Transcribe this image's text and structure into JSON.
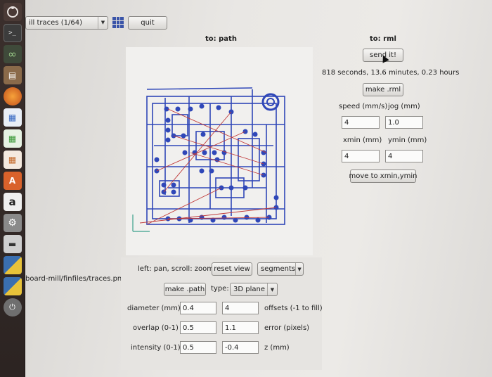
{
  "toolbar": {
    "selected_file": "ill traces (1/64)",
    "quit_label": "quit"
  },
  "left_column": {
    "header": "to: path",
    "file_path": "board-mill/finfiles/traces.png",
    "view_hint": "left: pan, scroll: zoom",
    "reset_view_label": "reset view",
    "display_mode": "segments",
    "make_path_label": "make .path",
    "type_label": "type:",
    "type_value": "3D plane",
    "params": {
      "diameter_label": "diameter (mm)",
      "diameter_value": "0.4",
      "offsets_value": "4",
      "offsets_label": "offsets (-1 to fill)",
      "overlap_label": "overlap (0-1)",
      "overlap_value": "0.5",
      "error_value": "1.1",
      "error_label": "error (pixels)",
      "intensity_label": "intensity (0-1)",
      "intensity_value": "0.5",
      "z_value": "-0.4",
      "z_label": "z (mm)"
    }
  },
  "right_column": {
    "header": "to: rml",
    "send_label": "send it!",
    "time_estimate": "818 seconds, 13.6 minutes, 0.23 hours",
    "make_rml_label": "make .rml",
    "speed_label": "speed (mm/s)",
    "speed_value": "4",
    "jog_label": "jog (mm)",
    "jog_value": "1.0",
    "xmin_label": "xmin (mm)",
    "xmin_value": "4",
    "ymin_label": "ymin (mm)",
    "ymin_value": "4",
    "move_label": "move to xmin,ymin"
  },
  "launcher": {
    "icons": [
      "ubuntu-dash-icon",
      "terminal-icon",
      "infinity-icon",
      "files-icon",
      "firefox-icon",
      "writer-icon",
      "calc-icon",
      "impress-icon",
      "software-center-icon",
      "amazon-icon",
      "settings-icon",
      "drive-icon",
      "python-icon",
      "python-icon",
      "updater-icon"
    ]
  },
  "colors": {
    "trace_blue": "#2f47b8",
    "path_red": "#c03a3a",
    "axis_green": "#3aa08a"
  }
}
